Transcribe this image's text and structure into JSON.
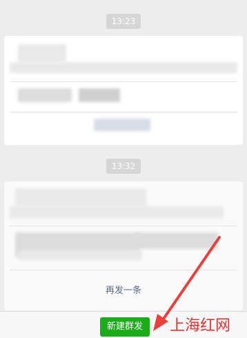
{
  "messages": [
    {
      "time": "13:23"
    },
    {
      "time": "13:32",
      "resend_label": "再发一条"
    }
  ],
  "footer": {
    "new_broadcast_label": "新建群发"
  },
  "watermark_text": "上海红网",
  "colors": {
    "accent_green": "#1aad19",
    "arrow_red": "#e8403a",
    "link_blue": "#5b6b8c"
  }
}
